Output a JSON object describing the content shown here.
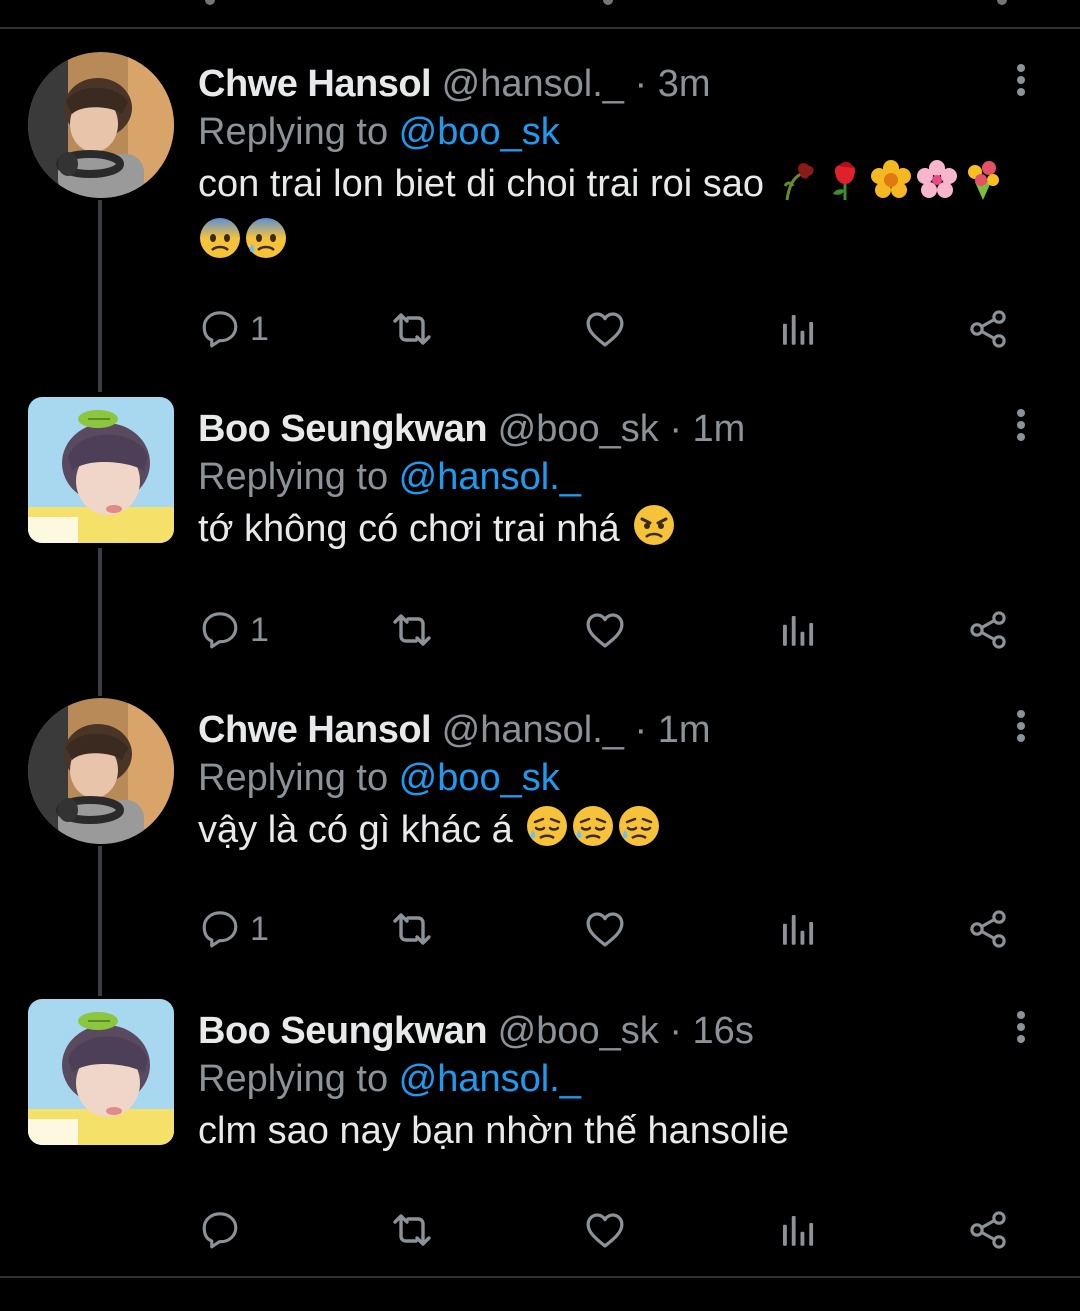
{
  "tweets": [
    {
      "author_name": "Chwe Hansol",
      "author_handle": "@hansol._",
      "separator": "·",
      "time": "3m",
      "replying_prefix": "Replying to ",
      "replying_handle": "@boo_sk",
      "text": "con trai lon biet di choi trai roi sao",
      "emoji_icons": [
        "wilted-flower-icon",
        "rose-icon",
        "blossom-icon",
        "cherry-blossom-icon",
        "bouquet-icon",
        "fearful-face-icon",
        "anxious-face-with-sweat-icon"
      ],
      "reply_count": "1"
    },
    {
      "author_name": "Boo Seungkwan",
      "author_handle": "@boo_sk",
      "separator": "·",
      "time": "1m",
      "replying_prefix": "Replying to ",
      "replying_handle": "@hansol._",
      "text": "tớ không có chơi trai nhá",
      "emoji_icons": [
        "angry-face-icon"
      ],
      "reply_count": "1"
    },
    {
      "author_name": "Chwe Hansol",
      "author_handle": "@hansol._",
      "separator": "·",
      "time": "1m",
      "replying_prefix": "Replying to ",
      "replying_handle": "@boo_sk",
      "text": "vậy là có gì khác á",
      "emoji_icons": [
        "sad-relieved-face-icon",
        "sad-relieved-face-icon",
        "sad-relieved-face-icon"
      ],
      "reply_count": "1"
    },
    {
      "author_name": "Boo Seungkwan",
      "author_handle": "@boo_sk",
      "separator": "·",
      "time": "16s",
      "replying_prefix": "Replying to ",
      "replying_handle": "@hansol._",
      "text": "clm sao nay bạn nhờn thế hansolie",
      "emoji_icons": [],
      "reply_count": ""
    }
  ],
  "action_icons": [
    "reply-icon",
    "retweet-icon",
    "like-icon",
    "views-icon",
    "share-icon"
  ],
  "colors": {
    "background": "#000000",
    "text": "#e7e9ea",
    "muted": "#8b9298",
    "mention": "#1d9bf0",
    "thread_line": "#3a3d41",
    "divider": "#2f3336"
  }
}
